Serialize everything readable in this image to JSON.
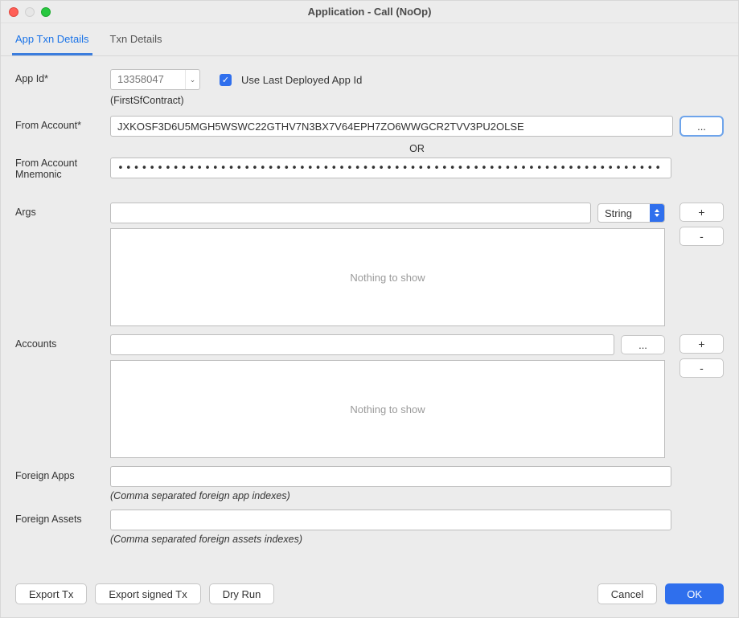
{
  "window": {
    "title": "Application - Call (NoOp)"
  },
  "tabs": {
    "active": "App Txn Details",
    "items": [
      "App Txn Details",
      "Txn Details"
    ]
  },
  "form": {
    "appId": {
      "label": "App Id*",
      "value": "13358047",
      "checkboxLabel": "Use Last Deployed App Id",
      "contractName": "(FirstSfContract)"
    },
    "fromAccount": {
      "label": "From Account*",
      "value": "JXKOSF3D6U5MGH5WSWC22GTHV7N3BX7V64EPH7ZO6WWGCR2TVV3PU2OLSE",
      "ellipsis": "...",
      "orLabel": "OR"
    },
    "fromMnemonic": {
      "label": "From Account Mnemonic",
      "value": "••••••••••••••••••••••••••••••••••••••••••••••••••••••••••••••••••••••••••••••••••••••••••••••••••••••••••••••••••••••••••••••••"
    },
    "args": {
      "label": "Args",
      "typeSelected": "String",
      "plus": "+",
      "minus": "-",
      "emptyText": "Nothing to show"
    },
    "accounts": {
      "label": "Accounts",
      "ellipsis": "...",
      "plus": "+",
      "minus": "-",
      "emptyText": "Nothing to show"
    },
    "foreignApps": {
      "label": "Foreign Apps",
      "hint": "(Comma separated foreign app indexes)"
    },
    "foreignAssets": {
      "label": "Foreign Assets",
      "hint": "(Comma separated foreign assets indexes)"
    }
  },
  "footer": {
    "exportTx": "Export Tx",
    "exportSignedTx": "Export signed Tx",
    "dryRun": "Dry Run",
    "cancel": "Cancel",
    "ok": "OK"
  }
}
